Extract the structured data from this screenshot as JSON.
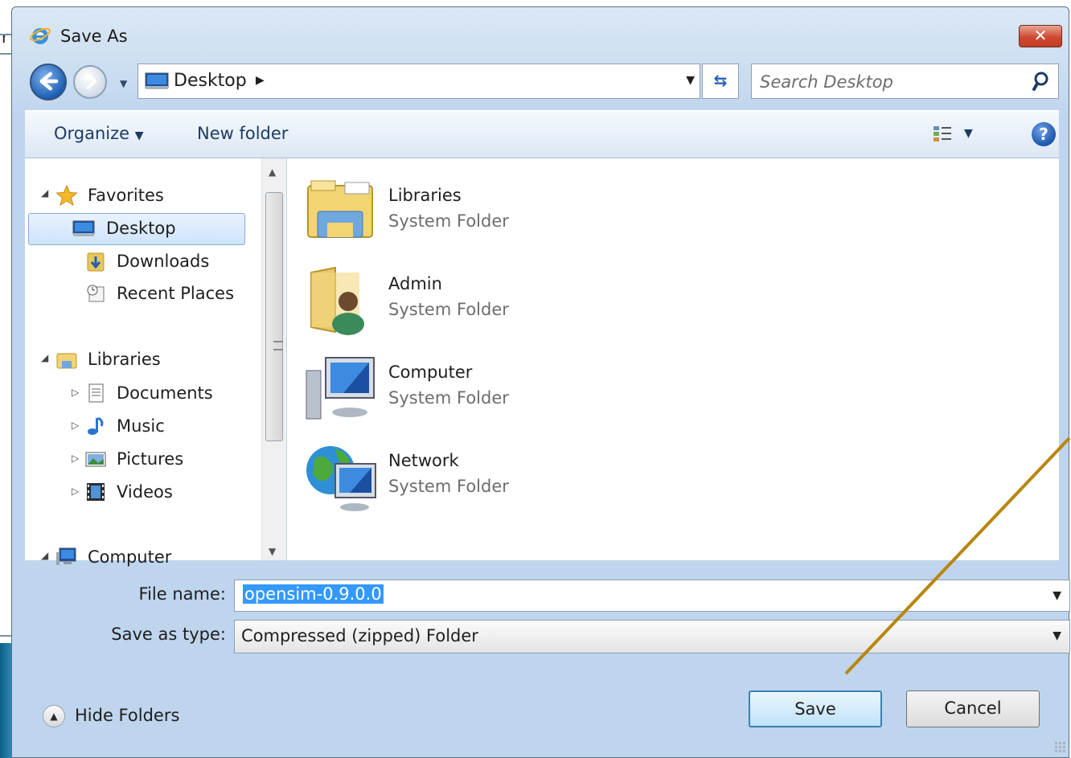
{
  "dialog": {
    "title": "Save As"
  },
  "background": {
    "partial_letter": "r"
  },
  "navigation": {
    "address_label": "Desktop",
    "search_placeholder": "Search Desktop"
  },
  "toolbar": {
    "organize": "Organize",
    "new_folder": "New folder"
  },
  "nav_pane": {
    "favorites": "Favorites",
    "desktop": "Desktop",
    "downloads": "Downloads",
    "recent_places": "Recent Places",
    "libraries": "Libraries",
    "documents": "Documents",
    "music": "Music",
    "pictures": "Pictures",
    "videos": "Videos",
    "computer": "Computer"
  },
  "files": [
    {
      "name": "Libraries",
      "type": "System Folder",
      "icon": "libraries-folder-icon"
    },
    {
      "name": "Admin",
      "type": "System Folder",
      "icon": "user-folder-icon"
    },
    {
      "name": "Computer",
      "type": "System Folder",
      "icon": "computer-icon"
    },
    {
      "name": "Network",
      "type": "System Folder",
      "icon": "network-icon"
    }
  ],
  "form": {
    "file_name_label": "File name:",
    "file_name_value": "opensim-0.9.0.0",
    "save_as_type_label": "Save as type:",
    "save_as_type_value": "Compressed (zipped) Folder"
  },
  "buttons": {
    "hide_folders": "Hide Folders",
    "save": "Save",
    "cancel": "Cancel"
  },
  "colors": {
    "annotation_arrow": "#b8860b",
    "selection": "#3399ff"
  }
}
